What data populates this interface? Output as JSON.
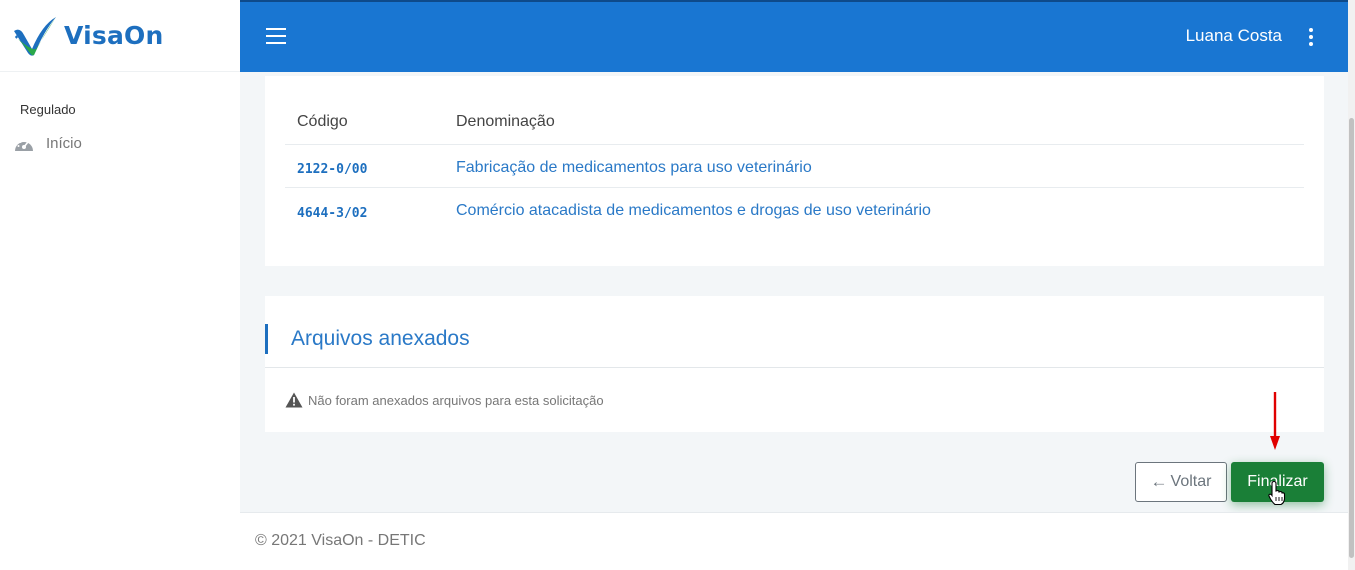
{
  "app": {
    "logo_text": "VisaOn"
  },
  "sidebar": {
    "section_label": "Regulado",
    "items": [
      {
        "label": "Início",
        "icon": "dashboard-icon"
      }
    ]
  },
  "header": {
    "username": "Luana Costa"
  },
  "table": {
    "headers": [
      "Código",
      "Denominação"
    ],
    "rows": [
      {
        "code": "2122-0/00",
        "denomination": "Fabricação de medicamentos para uso veterinário"
      },
      {
        "code": "4644-3/02",
        "denomination": "Comércio atacadista de medicamentos e drogas de uso veterinário"
      }
    ]
  },
  "files": {
    "title": "Arquivos anexados",
    "empty_message": "Não foram anexados arquivos para esta solicitação"
  },
  "actions": {
    "back_label": "Voltar",
    "finish_label": "Finalizar"
  },
  "footer": {
    "text": "© 2021 VisaOn - DETIC"
  },
  "colors": {
    "primary": "#1976d2",
    "link": "#2a79c7",
    "success": "#1a7f37",
    "annotation_arrow": "#e00000"
  }
}
